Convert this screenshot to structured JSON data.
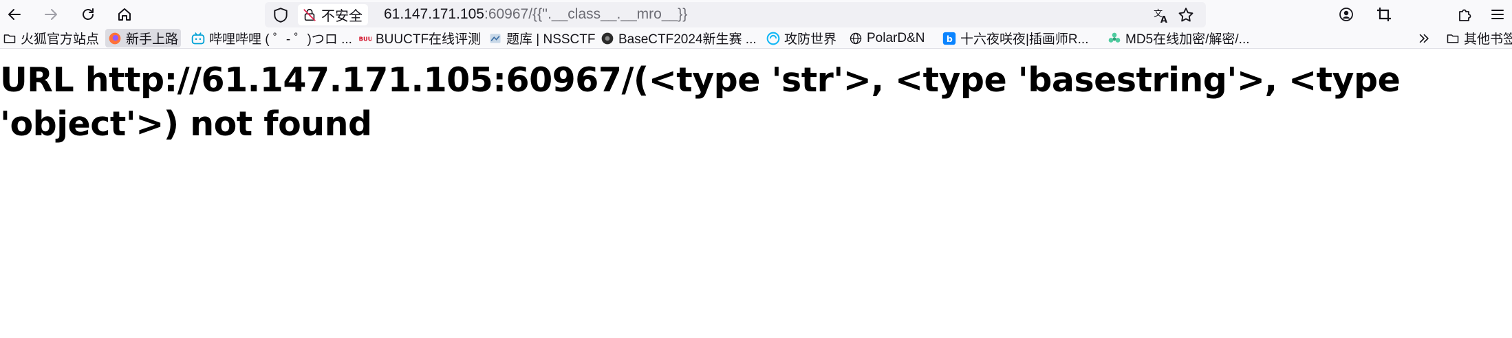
{
  "browser": {
    "security_label": "不安全",
    "url_host": "61.147.171.105",
    "url_rest": ":60967/{{''.__class__.__mro__}}"
  },
  "bookmarks": [
    {
      "label": "火狐官方站点",
      "icon": "folder-icon"
    },
    {
      "label": "新手上路",
      "icon": "firefox-icon"
    },
    {
      "label": "哔哩哔哩 ( ゜- ゜)つロ ...",
      "icon": "bilibili-icon"
    },
    {
      "label": "BUUCTF在线评测",
      "icon": "buuctf-icon"
    },
    {
      "label": "题库 | NSSCTF",
      "icon": "nssctf-icon"
    },
    {
      "label": "BaseCTF2024新生赛 ...",
      "icon": "basectf-icon"
    },
    {
      "label": "攻防世界",
      "icon": "adworld-icon"
    },
    {
      "label": "PolarD&N",
      "icon": "globe-icon"
    },
    {
      "label": "十六夜咲夜|插画师R...",
      "icon": "bing-icon"
    },
    {
      "label": "MD5在线加密/解密/...",
      "icon": "md5-icon"
    }
  ],
  "other_bookmarks_label": "其他书签",
  "page": {
    "message": "URL http://61.147.171.105:60967/(<type 'str'>, <type 'basestring'>, <type 'object'>) not found"
  },
  "colors": {
    "toolbar_bg": "#f9f9fb",
    "urlbar_bg": "#f0f0f4",
    "text": "#15141a"
  }
}
